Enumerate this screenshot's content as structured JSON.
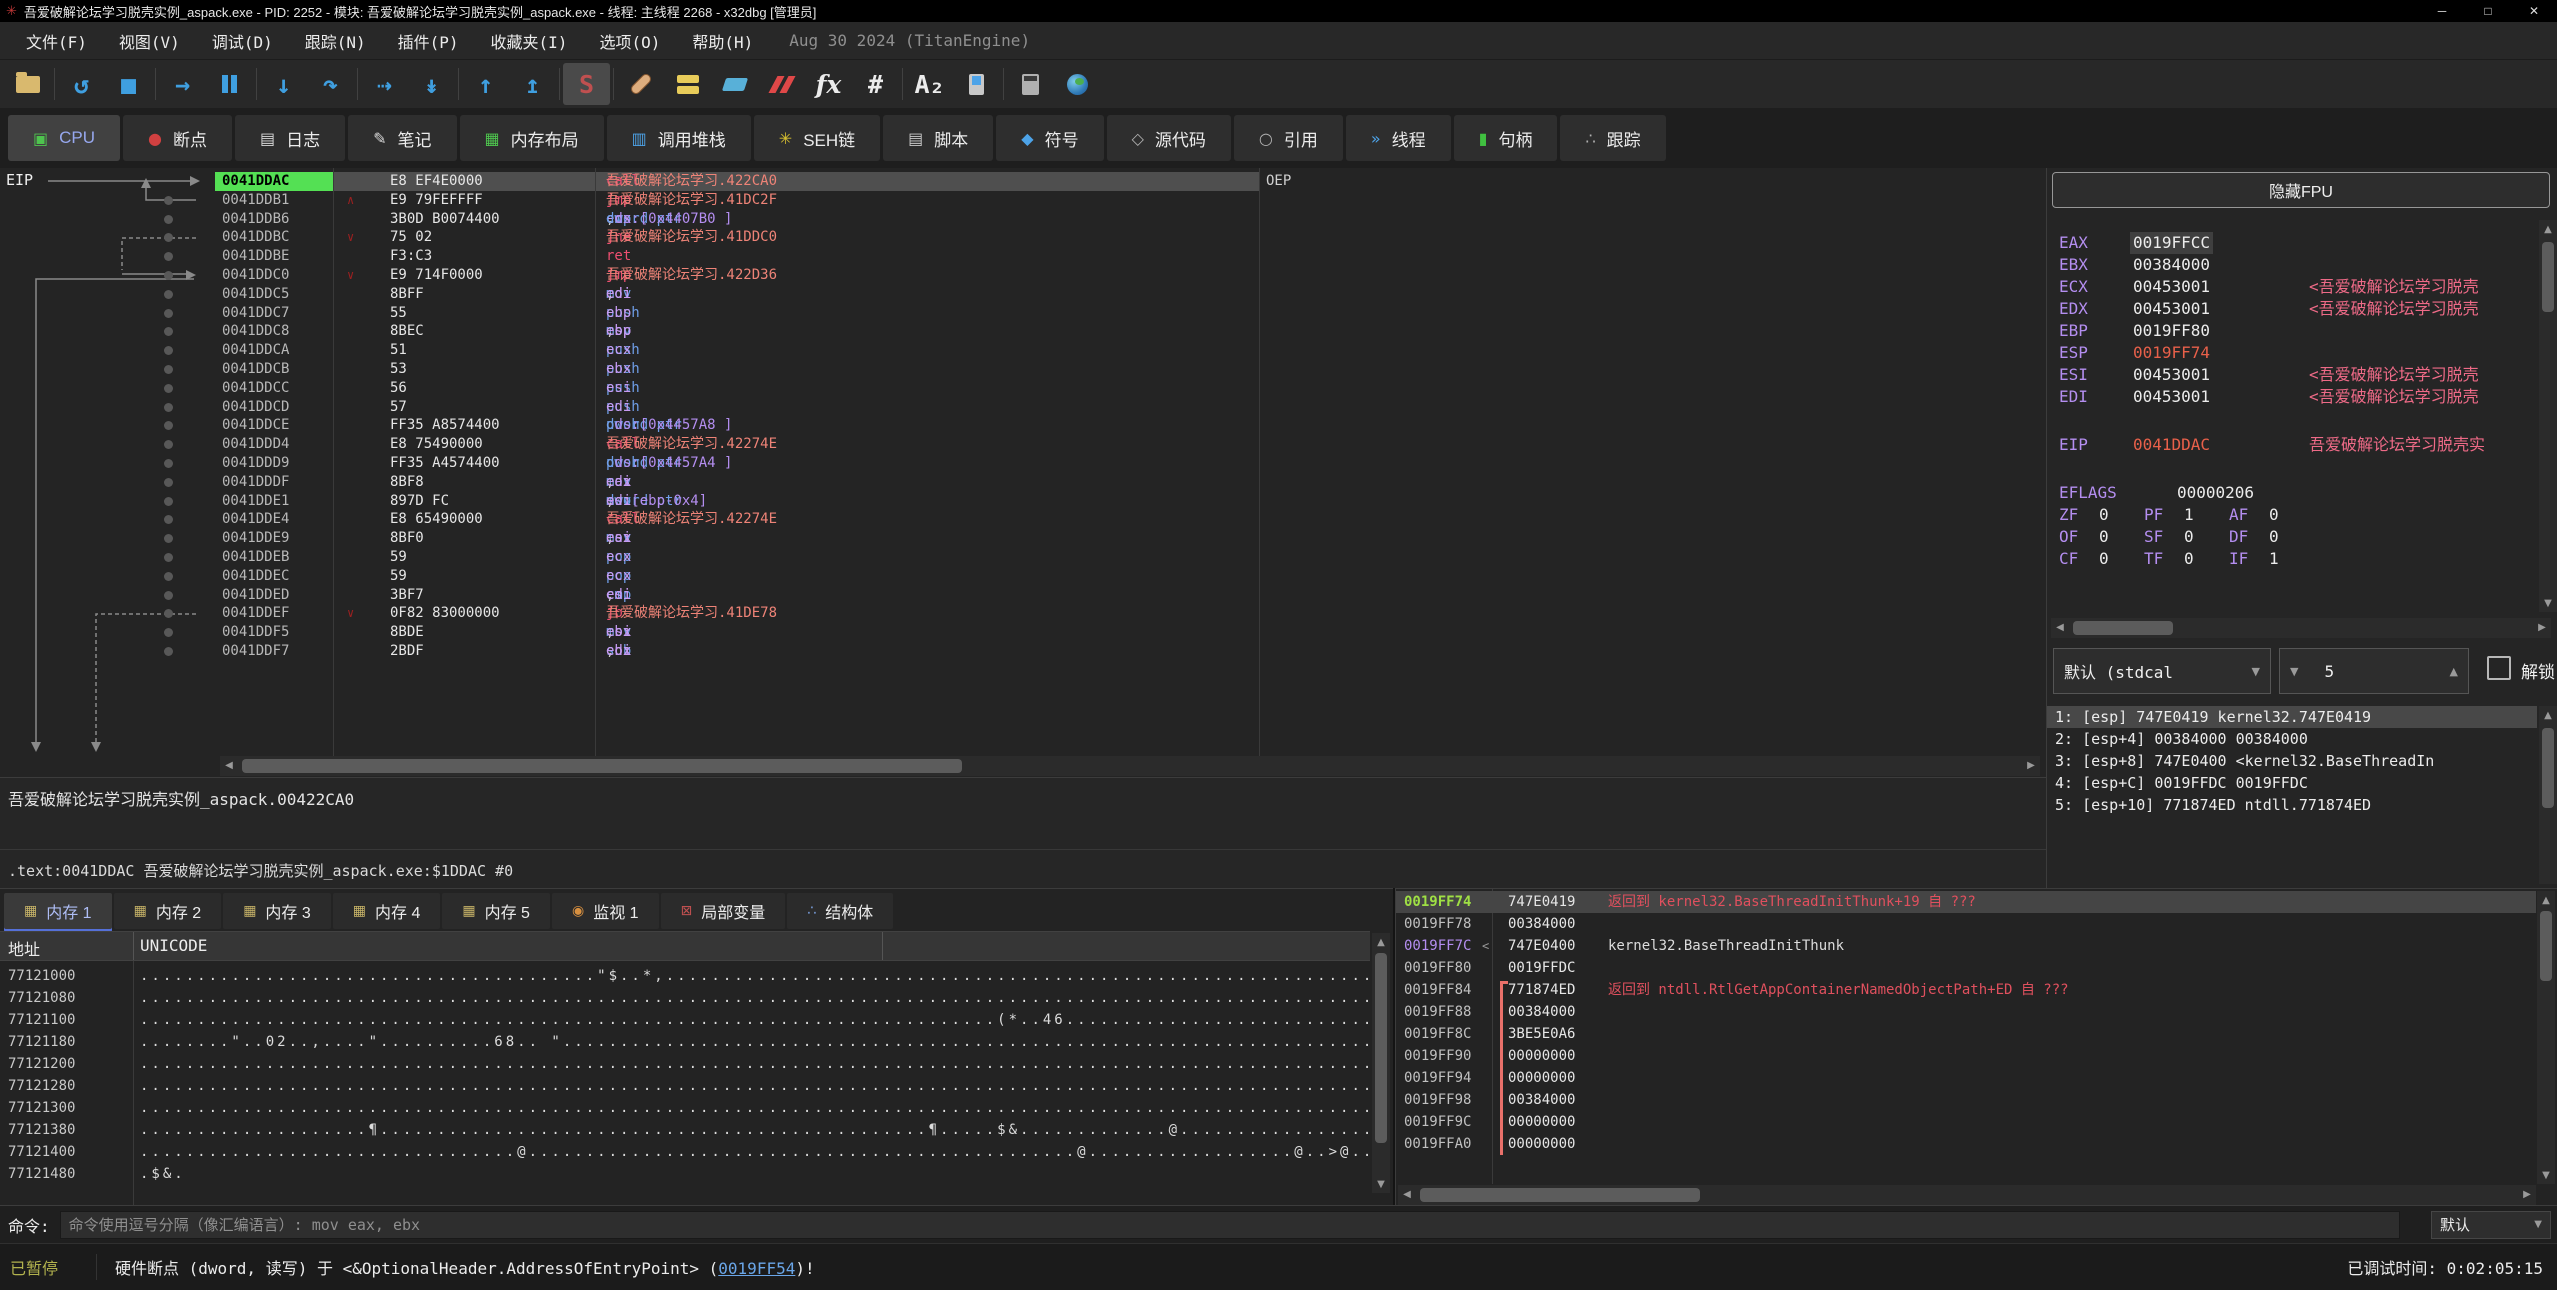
{
  "colors": {
    "eip-green": "#54e054",
    "mn-red": "#ef4f71",
    "mn-lbl": "#ee8377",
    "mn-blu": "#6f9ee8",
    "mn-reg": "#c79bf2",
    "mn-mem": "#b48ef0",
    "reg-cmt": "#ee6a87",
    "val-red": "#e8604a",
    "stk-green": "#9fe044",
    "stk-purple": "#b48ef0",
    "cmt-red": "#e0505e",
    "link-blue": "#6aa6e8",
    "paused": "#b2b24e",
    "tab-active": "#97a8ef"
  },
  "window": {
    "title": "吾爱破解论坛学习脱壳实例_aspack.exe - PID: 2252 - 模块: 吾爱破解论坛学习脱壳实例_aspack.exe - 线程: 主线程 2268 - x32dbg [管理员]",
    "icon_glyph": "✳",
    "controls": [
      {
        "name": "minimize-button",
        "glyph": "─"
      },
      {
        "name": "maximize-button",
        "glyph": "□"
      },
      {
        "name": "close-button",
        "glyph": "✕"
      }
    ]
  },
  "menu": {
    "items": [
      "文件(F)",
      "视图(V)",
      "调试(D)",
      "跟踪(N)",
      "插件(P)",
      "收藏夹(I)",
      "选项(O)",
      "帮助(H)"
    ],
    "build_info": "Aug 30 2024 (TitanEngine)"
  },
  "toolbar": {
    "separators_after": [
      0,
      2,
      4,
      6,
      8,
      10,
      11,
      17,
      19
    ],
    "icons": [
      {
        "name": "open-file-icon",
        "shape": "folder"
      },
      {
        "name": "restart-icon",
        "glyph": "↺",
        "color": "#3f9fe0"
      },
      {
        "name": "stop-icon",
        "glyph": "■",
        "color": "#3f9fe0"
      },
      {
        "name": "run-icon",
        "glyph": "→",
        "color": "#3f9fe0"
      },
      {
        "name": "pause-icon",
        "shape": "pause"
      },
      {
        "name": "step-into-icon",
        "glyph": "↓",
        "color": "#3f9fe0"
      },
      {
        "name": "step-over-icon",
        "glyph": "↷",
        "color": "#3f9fe0"
      },
      {
        "name": "trace-over-icon",
        "glyph": "⇢",
        "color": "#3f9fe0"
      },
      {
        "name": "execute-till-return-icon",
        "glyph": "↡",
        "color": "#3f9fe0"
      },
      {
        "name": "step-out-icon",
        "glyph": "↑",
        "color": "#3f9fe0"
      },
      {
        "name": "run-to-user-code-icon",
        "glyph": "↥",
        "color": "#3f9fe0"
      },
      {
        "name": "source-icon",
        "glyph": "S",
        "color": "#c05050",
        "active": true
      },
      {
        "name": "patch-icon",
        "shape": "patch"
      },
      {
        "name": "comments-icon",
        "shape": "notes"
      },
      {
        "name": "labels-icon",
        "shape": "tags"
      },
      {
        "name": "breakpoints-icon",
        "shape": "bp"
      },
      {
        "name": "functions-icon",
        "glyph": "fx",
        "color": "#ececec",
        "italic": true
      },
      {
        "name": "hash-icon",
        "glyph": "#",
        "color": "#ececec"
      },
      {
        "name": "font-icon",
        "glyph": "A₂",
        "color": "#ececec"
      },
      {
        "name": "device-icon",
        "shape": "phone"
      },
      {
        "name": "calculator-icon",
        "shape": "calc"
      },
      {
        "name": "globe-icon",
        "shape": "globe"
      }
    ]
  },
  "tabs": [
    {
      "label": "CPU",
      "icon": "cpu-icon",
      "glyph": "▣",
      "color": "#4ec44e",
      "active": true
    },
    {
      "label": "断点",
      "icon": "breakpoint-icon",
      "glyph": "●",
      "color": "#d04040"
    },
    {
      "label": "日志",
      "icon": "log-icon",
      "glyph": "▤",
      "color": "#d8d8d8"
    },
    {
      "label": "笔记",
      "icon": "notes-icon",
      "glyph": "✎",
      "color": "#d8d8d8"
    },
    {
      "label": "内存布局",
      "icon": "memory-map-icon",
      "glyph": "▦",
      "color": "#4ec44e"
    },
    {
      "label": "调用堆栈",
      "icon": "call-stack-icon",
      "glyph": "▥",
      "color": "#4da3e8"
    },
    {
      "label": "SEH链",
      "icon": "seh-chain-icon",
      "glyph": "✳",
      "color": "#d8c030"
    },
    {
      "label": "脚本",
      "icon": "script-icon",
      "glyph": "▤",
      "color": "#c8c8c8"
    },
    {
      "label": "符号",
      "icon": "symbols-icon",
      "glyph": "◆",
      "color": "#4da3e8"
    },
    {
      "label": "源代码",
      "icon": "source-code-icon",
      "glyph": "◇",
      "color": "#b0b0b0"
    },
    {
      "label": "引用",
      "icon": "references-icon",
      "glyph": "○",
      "color": "#b0b0b0"
    },
    {
      "label": "线程",
      "icon": "threads-icon",
      "glyph": "»",
      "color": "#4da3e8"
    },
    {
      "label": "句柄",
      "icon": "handles-icon",
      "glyph": "▮",
      "color": "#40c040"
    },
    {
      "label": "跟踪",
      "icon": "trace-icon",
      "glyph": "∴",
      "color": "#b0b0b0"
    }
  ],
  "disasm": {
    "eip_label": "EIP",
    "rows": [
      {
        "addr": "0041DDAC",
        "bytes": "E8 EF4E0000",
        "sel": true,
        "cmt": "OEP",
        "ins": [
          [
            "call ",
            "red"
          ],
          [
            "吾爱破解论坛学习.422CA0",
            "lbl"
          ]
        ]
      },
      {
        "addr": "0041DDB1",
        "bytes": "E9 79FEFFFF",
        "chev": "up",
        "ins": [
          [
            "jmp ",
            "red"
          ],
          [
            "吾爱破解论坛学习.41DC2F",
            "lbl"
          ]
        ]
      },
      {
        "addr": "0041DDB6",
        "bytes": "3B0D B0074400",
        "ins": [
          [
            "cmp ",
            "blu"
          ],
          [
            "ecx",
            "reg"
          ],
          [
            ",",
            "pln"
          ],
          [
            "dword ptr ",
            "blu"
          ],
          [
            " ds:[0x4407B0 ]",
            "mem"
          ]
        ]
      },
      {
        "addr": "0041DDBC",
        "bytes": "75 02",
        "chev": "dn",
        "ins": [
          [
            "jne ",
            "red"
          ],
          [
            "吾爱破解论坛学习.41DDC0",
            "lbl"
          ]
        ]
      },
      {
        "addr": "0041DDBE",
        "bytes": "F3:C3",
        "ins": [
          [
            "ret",
            "red"
          ]
        ]
      },
      {
        "addr": "0041DDC0",
        "bytes": "E9 714F0000",
        "chev": "dn",
        "ins": [
          [
            "jmp ",
            "red"
          ],
          [
            "吾爱破解论坛学习.422D36",
            "lbl"
          ]
        ]
      },
      {
        "addr": "0041DDC5",
        "bytes": "8BFF",
        "ins": [
          [
            "mov ",
            "blu"
          ],
          [
            "edi",
            "reg"
          ],
          [
            ",",
            "pln"
          ],
          [
            "edi",
            "reg"
          ]
        ]
      },
      {
        "addr": "0041DDC7",
        "bytes": "55",
        "ins": [
          [
            "push ",
            "blu"
          ],
          [
            "ebp",
            "reg"
          ]
        ]
      },
      {
        "addr": "0041DDC8",
        "bytes": "8BEC",
        "ins": [
          [
            "mov ",
            "blu"
          ],
          [
            "ebp",
            "reg"
          ],
          [
            ",",
            "pln"
          ],
          [
            "esp",
            "reg"
          ]
        ]
      },
      {
        "addr": "0041DDCA",
        "bytes": "51",
        "ins": [
          [
            "push ",
            "blu"
          ],
          [
            "ecx",
            "reg"
          ]
        ]
      },
      {
        "addr": "0041DDCB",
        "bytes": "53",
        "ins": [
          [
            "push ",
            "blu"
          ],
          [
            "ebx",
            "reg"
          ]
        ]
      },
      {
        "addr": "0041DDCC",
        "bytes": "56",
        "ins": [
          [
            "push ",
            "blu"
          ],
          [
            "esi",
            "reg"
          ]
        ]
      },
      {
        "addr": "0041DDCD",
        "bytes": "57",
        "ins": [
          [
            "push ",
            "blu"
          ],
          [
            "edi",
            "reg"
          ]
        ]
      },
      {
        "addr": "0041DDCE",
        "bytes": "FF35 A8574400",
        "ins": [
          [
            "push ",
            "blu"
          ],
          [
            "dword ptr ",
            "blu"
          ],
          [
            " ds:[0x4457A8 ]",
            "mem"
          ]
        ]
      },
      {
        "addr": "0041DDD4",
        "bytes": "E8 75490000",
        "ins": [
          [
            "call ",
            "red"
          ],
          [
            "吾爱破解论坛学习.42274E",
            "lbl"
          ]
        ]
      },
      {
        "addr": "0041DDD9",
        "bytes": "FF35 A4574400",
        "ins": [
          [
            "push ",
            "blu"
          ],
          [
            "dword ptr ",
            "blu"
          ],
          [
            " ds:[0x4457A4 ]",
            "mem"
          ]
        ]
      },
      {
        "addr": "0041DDDF",
        "bytes": "8BF8",
        "ins": [
          [
            "mov ",
            "blu"
          ],
          [
            "edi",
            "reg"
          ],
          [
            ",",
            "pln"
          ],
          [
            "eax",
            "reg"
          ]
        ]
      },
      {
        "addr": "0041DDE1",
        "bytes": "897D FC",
        "ins": [
          [
            "mov ",
            "blu"
          ],
          [
            "dword ptr ",
            "blu"
          ],
          [
            "ss:[ebp-0x4]",
            "mem"
          ],
          [
            ",",
            "pln"
          ],
          [
            "edi",
            "reg"
          ]
        ]
      },
      {
        "addr": "0041DDE4",
        "bytes": "E8 65490000",
        "ins": [
          [
            "call ",
            "red"
          ],
          [
            "吾爱破解论坛学习.42274E",
            "lbl"
          ]
        ]
      },
      {
        "addr": "0041DDE9",
        "bytes": "8BF0",
        "ins": [
          [
            "mov ",
            "blu"
          ],
          [
            "esi",
            "reg"
          ],
          [
            ",",
            "pln"
          ],
          [
            "eax",
            "reg"
          ]
        ]
      },
      {
        "addr": "0041DDEB",
        "bytes": "59",
        "ins": [
          [
            "pop ",
            "blu"
          ],
          [
            "ecx",
            "reg"
          ]
        ]
      },
      {
        "addr": "0041DDEC",
        "bytes": "59",
        "ins": [
          [
            "pop ",
            "blu"
          ],
          [
            "ecx",
            "reg"
          ]
        ]
      },
      {
        "addr": "0041DDED",
        "bytes": "3BF7",
        "ins": [
          [
            "cmp ",
            "blu"
          ],
          [
            "esi",
            "reg"
          ],
          [
            ",",
            "pln"
          ],
          [
            "edi",
            "reg"
          ]
        ]
      },
      {
        "addr": "0041DDEF",
        "bytes": "0F82 83000000",
        "chev": "dn",
        "ins": [
          [
            "jb ",
            "red"
          ],
          [
            "吾爱破解论坛学习.41DE78",
            "lbl"
          ]
        ]
      },
      {
        "addr": "0041DDF5",
        "bytes": "8BDE",
        "ins": [
          [
            "mov ",
            "blu"
          ],
          [
            "ebx",
            "reg"
          ],
          [
            ",",
            "pln"
          ],
          [
            "esi",
            "reg"
          ]
        ]
      },
      {
        "addr": "0041DDF7",
        "bytes": "2BDF",
        "ins": [
          [
            "sub ",
            "blu"
          ],
          [
            "ebx",
            "reg"
          ],
          [
            ",",
            "pln"
          ],
          [
            "edi",
            "reg"
          ]
        ]
      }
    ]
  },
  "registers": {
    "fpu_button": "隐藏FPU",
    "rows": [
      {
        "n": "EAX",
        "v": "0019FFCC",
        "u": "y",
        "vsel": true
      },
      {
        "n": "EBX",
        "v": "00384000"
      },
      {
        "n": "ECX",
        "v": "00453001",
        "u": "y",
        "c": "<吾爱破解论坛学习脱壳"
      },
      {
        "n": "EDX",
        "v": "00453001",
        "u": "y",
        "c": "<吾爱破解论坛学习脱壳"
      },
      {
        "n": "EBP",
        "v": "0019FF80"
      },
      {
        "n": "ESP",
        "v": "0019FF74",
        "u": "r",
        "vr": true
      },
      {
        "n": "ESI",
        "v": "00453001",
        "c": "<吾爱破解论坛学习脱壳"
      },
      {
        "n": "EDI",
        "v": "00453001",
        "c": "<吾爱破解论坛学习脱壳"
      },
      {
        "sp": true
      },
      {
        "n": "EIP",
        "v": "0041DDAC",
        "vr": true,
        "c": "吾爱破解论坛学习脱壳实"
      },
      {
        "sp": true
      },
      {
        "n": "EFLAGS",
        "v": "00000206"
      }
    ],
    "flags": [
      [
        {
          "n": "ZF",
          "v": "0"
        },
        {
          "n": "PF",
          "v": "1"
        },
        {
          "n": "AF",
          "v": "0"
        }
      ],
      [
        {
          "n": "OF",
          "v": "0"
        },
        {
          "n": "SF",
          "v": "0"
        },
        {
          "n": "DF",
          "v": "0"
        }
      ],
      [
        {
          "n": "CF",
          "v": "0"
        },
        {
          "n": "TF",
          "v": "0"
        },
        {
          "n": "IF",
          "v": "1"
        }
      ]
    ]
  },
  "args": {
    "convention": "默认 (stdcal",
    "count": "5",
    "unlock_label": "解锁",
    "rows": [
      {
        "text": "1: [esp] 747E0419 kernel32.747E0419",
        "selected": true
      },
      {
        "text": "2: [esp+4] 00384000 00384000"
      },
      {
        "text": "3: [esp+8] 747E0400 <kernel32.BaseThreadIn"
      },
      {
        "text": "4: [esp+C] 0019FFDC 0019FFDC"
      },
      {
        "text": "5: [esp+10] 771874ED ntdll.771874ED"
      }
    ]
  },
  "info": {
    "line1": "吾爱破解论坛学习脱壳实例_aspack.00422CA0",
    "line2": ".text:0041DDAC 吾爱破解论坛学习脱壳实例_aspack.exe:$1DDAC #0"
  },
  "dump": {
    "tabs": [
      {
        "label": "内存 1",
        "icon": "memory-icon",
        "glyph": "▦",
        "color": "#c8b468",
        "active": true
      },
      {
        "label": "内存 2",
        "icon": "memory-icon",
        "glyph": "▦",
        "color": "#c8b468"
      },
      {
        "label": "内存 3",
        "icon": "memory-icon",
        "glyph": "▦",
        "color": "#c8b468"
      },
      {
        "label": "内存 4",
        "icon": "memory-icon",
        "glyph": "▦",
        "color": "#c8b468"
      },
      {
        "label": "内存 5",
        "icon": "memory-icon",
        "glyph": "▦",
        "color": "#c8b468"
      },
      {
        "label": "监视 1",
        "icon": "watch-icon",
        "glyph": "◉",
        "color": "#d89040"
      },
      {
        "label": "局部变量",
        "icon": "locals-icon",
        "glyph": "⊠",
        "color": "#c05050"
      },
      {
        "label": "结构体",
        "icon": "struct-icon",
        "glyph": "∴",
        "color": "#7aa0e0"
      }
    ],
    "headers": {
      "address": "地址",
      "unicode": "UNICODE"
    },
    "rows": [
      {
        "addr": "77121000",
        "text": "........................................\"$..*,......................................................................................................"
      },
      {
        "addr": "77121080",
        "text": "................................................................................................................................................."
      },
      {
        "addr": "77121100",
        "text": "...........................................................................(*..46.................................................................."
      },
      {
        "addr": "77121180",
        "text": "........\"..02..,....\"..........68.. \"..............................................................................................................."
      },
      {
        "addr": "77121200",
        "text": "................................................................................................................................................."
      },
      {
        "addr": "77121280",
        "text": "................................................................................................................................................."
      },
      {
        "addr": "77121300",
        "text": "................................................................................................................................................."
      },
      {
        "addr": "77121380",
        "text": "....................¶................................................¶.....$&.............@......................................................"
      },
      {
        "addr": "77121400",
        "text": ".................................@................................................@..................@..>@........................................"
      },
      {
        "addr": "77121480",
        "text": ".$&."
      }
    ]
  },
  "stack": {
    "rows": [
      {
        "addr": "0019FF74",
        "ac": "grn",
        "val": "747E0419",
        "cmt": "返回到 kernel32.BaseThreadInitThunk+19 自 ???",
        "cc": "red",
        "sel": true
      },
      {
        "addr": "0019FF78",
        "val": "00384000"
      },
      {
        "addr": "0019FF7C",
        "ac": "pur",
        "mark": "<",
        "val": "747E0400",
        "cmt": "kernel32.BaseThreadInitThunk",
        "cc": "pln"
      },
      {
        "addr": "0019FF80",
        "val": "0019FFDC"
      },
      {
        "addr": "0019FF84",
        "val": "771874ED",
        "cmt": "返回到 ntdll.RtlGetAppContainerNamedObjectPath+ED 自 ???",
        "cc": "red",
        "br": "start"
      },
      {
        "addr": "0019FF88",
        "val": "00384000",
        "br": "mid"
      },
      {
        "addr": "0019FF8C",
        "val": "3BE5E0A6",
        "br": "mid"
      },
      {
        "addr": "0019FF90",
        "val": "00000000",
        "br": "mid"
      },
      {
        "addr": "0019FF94",
        "val": "00000000",
        "br": "mid"
      },
      {
        "addr": "0019FF98",
        "val": "00384000",
        "br": "mid"
      },
      {
        "addr": "0019FF9C",
        "val": "00000000",
        "br": "mid"
      },
      {
        "addr": "0019FFA0",
        "val": "00000000",
        "br": "mid"
      }
    ]
  },
  "command": {
    "label": "命令:",
    "placeholder": "命令使用逗号分隔（像汇编语言）: mov eax, ebx",
    "profile": "默认"
  },
  "status": {
    "state": "已暂停",
    "msg_pre": "硬件断点 (dword, 读写) 于 <&OptionalHeader.AddressOfEntryPoint> (",
    "msg_link": "0019FF54",
    "msg_post": ")!",
    "time": "已调试时间: 0:02:05:15"
  }
}
